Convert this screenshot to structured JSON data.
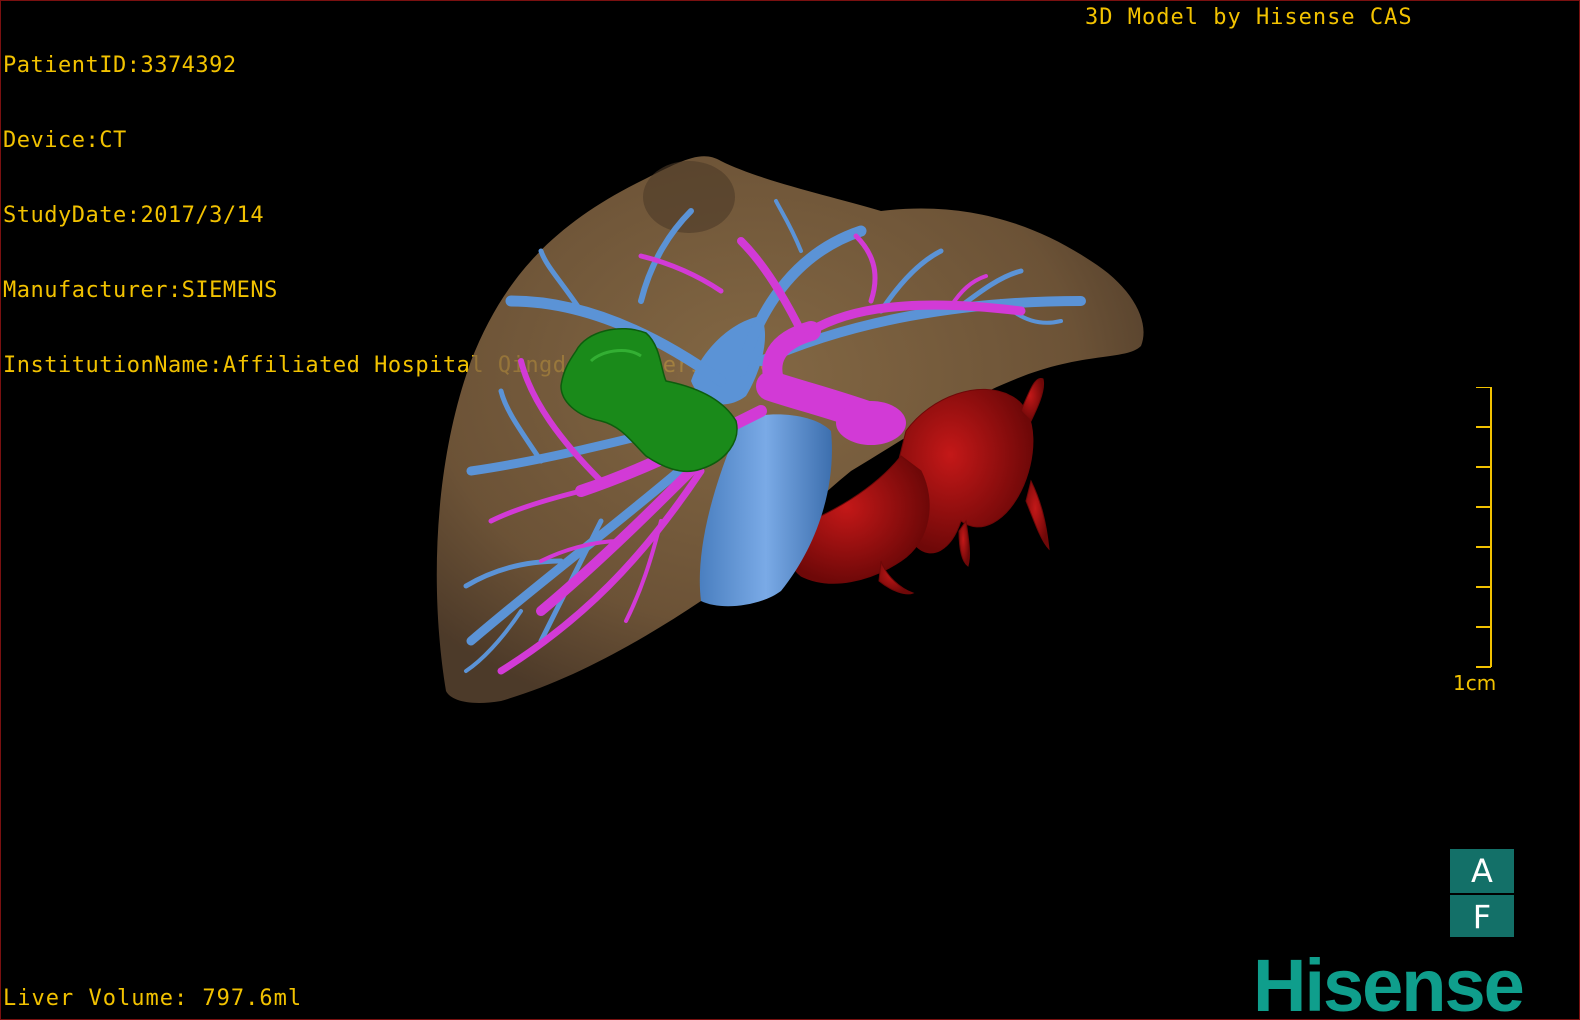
{
  "dicom": {
    "patient_id": "PatientID:3374392",
    "device": "Device:CT",
    "study_date": "StudyDate:2017/3/14",
    "manufacturer": "Manufacturer:SIEMENS",
    "institution": "InstitutionName:Affiliated Hospital Qingdao University-C"
  },
  "model_credit": "3D Model by Hisense CAS",
  "scale": {
    "label": "1cm"
  },
  "orientation": {
    "top": "A",
    "bottom": "F"
  },
  "liver_volume": "Liver Volume: 797.6ml",
  "brand": "Hisense",
  "colors": {
    "text": "#f2c200",
    "liver": "#8a6a42",
    "hepatic_vein": "#5b93d6",
    "portal_vein": "#d23ad6",
    "tumor": "#1a8a1a",
    "artery": "#9c1010",
    "brand": "#0f9e8c",
    "orientation_box": "#137068"
  }
}
